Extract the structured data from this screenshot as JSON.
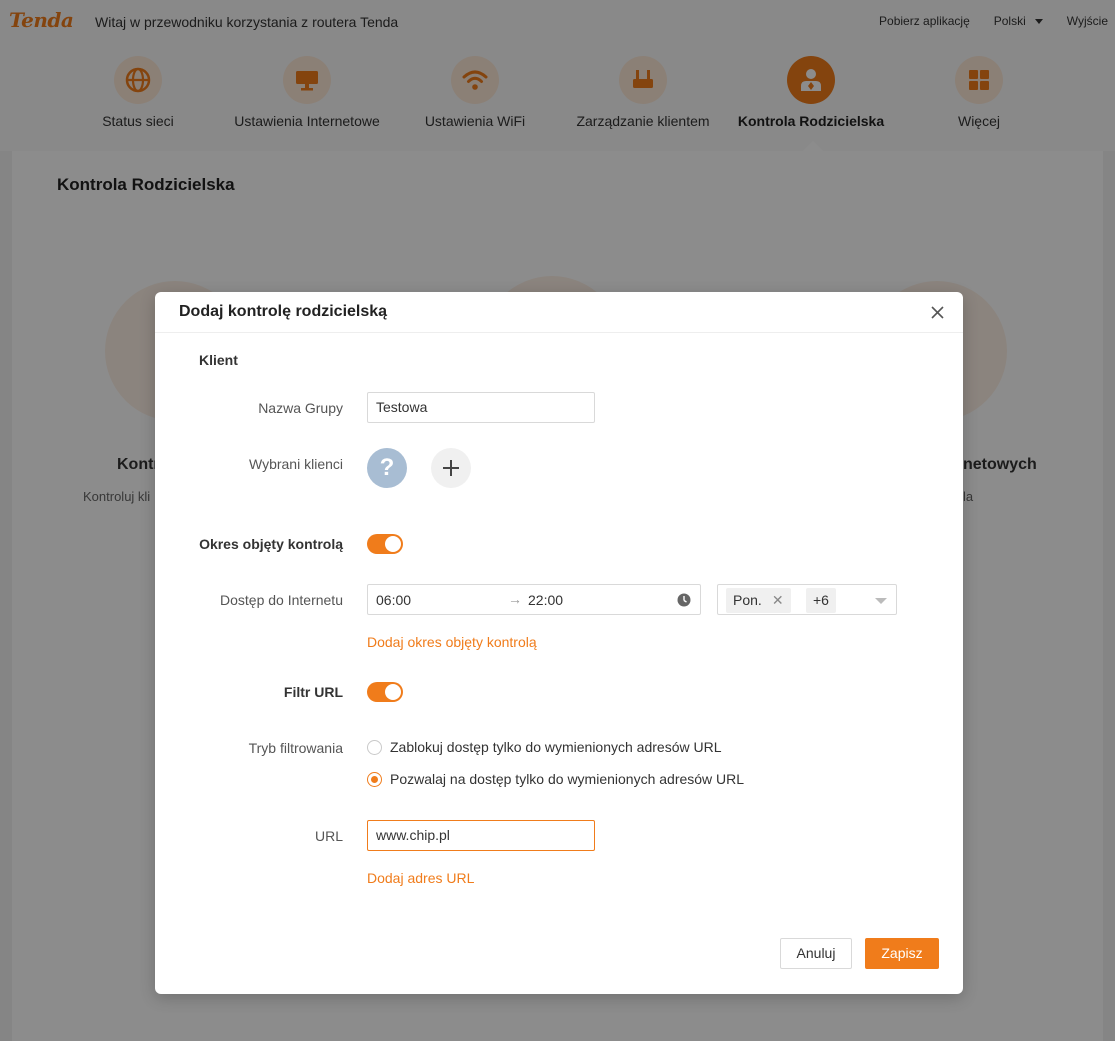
{
  "colors": {
    "accent": "#f07c1b",
    "accent_light": "#fde9d7",
    "overlay": "rgba(0,0,0,0.45)",
    "avatar": "#a8bdd3"
  },
  "topbar": {
    "logo": "Tenda",
    "welcome": "Witaj w przewodniku korzystania z routera Tenda",
    "download_app": "Pobierz aplikację",
    "language": "Polski",
    "logout": "Wyjście"
  },
  "nav": {
    "items": [
      {
        "label": "Status sieci",
        "icon": "globe-icon"
      },
      {
        "label": "Ustawienia Internetowe",
        "icon": "monitor-icon"
      },
      {
        "label": "Ustawienia WiFi",
        "icon": "wifi-icon"
      },
      {
        "label": "Zarządzanie klientem",
        "icon": "router-icon"
      },
      {
        "label": "Kontrola Rodzicielska",
        "icon": "parent-icon",
        "active": true
      },
      {
        "label": "Więcej",
        "icon": "grid-icon"
      }
    ]
  },
  "page": {
    "title": "Kontrola Rodzicielska",
    "bg_card_left_title": "Kontr",
    "bg_card_left_sub": "Kontroluj kli",
    "bg_card_right_title": "netowych",
    "bg_card_right_sub": "la"
  },
  "modal": {
    "title": "Dodaj kontrolę rodzicielską",
    "client_section": "Klient",
    "group_name_label": "Nazwa Grupy",
    "group_name_value": "Testowa",
    "selected_clients_label": "Wybrani klienci",
    "unknown_client_glyph": "?",
    "period_label": "Okres objęty kontrolą",
    "period_enabled": true,
    "internet_access_label": "Dostęp do Internetu",
    "time_start": "06:00",
    "time_arrow": "→",
    "time_end": "22:00",
    "days_tag": "Pon.",
    "days_more": "+6",
    "add_period_link": "Dodaj okres objęty kontrolą",
    "url_filter_label": "Filtr URL",
    "url_filter_enabled": true,
    "filter_mode_label": "Tryb filtrowania",
    "filter_options": [
      {
        "label": "Zablokuj dostęp tylko do wymienionych adresów URL",
        "checked": false
      },
      {
        "label": "Pozwalaj na dostęp tylko do wymienionych adresów URL",
        "checked": true
      }
    ],
    "url_label": "URL",
    "url_value": "www.chip.pl",
    "add_url_link": "Dodaj adres URL",
    "cancel_label": "Anuluj",
    "save_label": "Zapisz"
  }
}
